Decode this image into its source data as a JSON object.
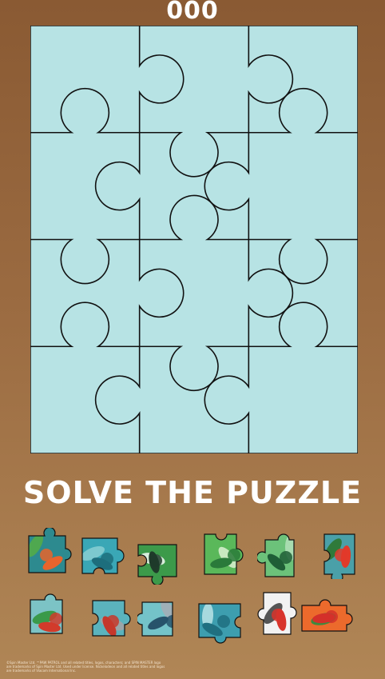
{
  "game": {
    "score": "000",
    "title": "SOLVE THE PUZZLE",
    "legal_line1": "©Spin Master Ltd. ™PAW PATROL and all related titles, logos, characters; and SPIN MASTER logo",
    "legal_line2": "are trademarks of Spin Master Ltd. Used under license. Nickelodeon and all related titles and logos",
    "legal_line3": "are trademarks of Viacom International Inc."
  },
  "board": {
    "rows": 4,
    "cols": 3,
    "slot_color": "#b7e3e4",
    "outline_color": "#111111"
  },
  "tray": {
    "pieces": [
      {
        "name": "piece-1",
        "bg": "#2d8a8f",
        "accent": "#e8642c",
        "leaf": "#4fa84f"
      },
      {
        "name": "piece-2",
        "bg": "#3aa7b6",
        "accent": "#1d6e7d",
        "leaf": "#7dc9cf"
      },
      {
        "name": "piece-3",
        "bg": "#3c9a4a",
        "accent": "#1f3b2a",
        "leaf": "#d8eedc"
      },
      {
        "name": "piece-4",
        "bg": "#5ab85a",
        "accent": "#2a7a3a",
        "leaf": "#c8e8c0"
      },
      {
        "name": "piece-5",
        "bg": "#6cc27a",
        "accent": "#1f5e36",
        "leaf": "#a8dcb0"
      },
      {
        "name": "piece-6",
        "bg": "#4aa0a8",
        "accent": "#e23a2a",
        "leaf": "#2f7a3a"
      },
      {
        "name": "piece-7",
        "bg": "#7cc3c5",
        "accent": "#d23b2b",
        "leaf": "#3a9a4a"
      },
      {
        "name": "piece-8",
        "bg": "#5bb3bd",
        "accent": "#c5372b",
        "leaf": "#9aa5a8"
      },
      {
        "name": "piece-9",
        "bg": "#74c3c9",
        "accent": "#27536b",
        "leaf": "#9fb0b8"
      },
      {
        "name": "piece-10",
        "bg": "#3d9eaf",
        "accent": "#1f6f80",
        "leaf": "#a7d9de"
      },
      {
        "name": "piece-11",
        "bg": "#f2f2f2",
        "accent": "#d8342b",
        "leaf": "#555555"
      },
      {
        "name": "piece-12",
        "bg": "#ec6a2c",
        "accent": "#d4302a",
        "leaf": "#3e8a3e"
      }
    ]
  }
}
